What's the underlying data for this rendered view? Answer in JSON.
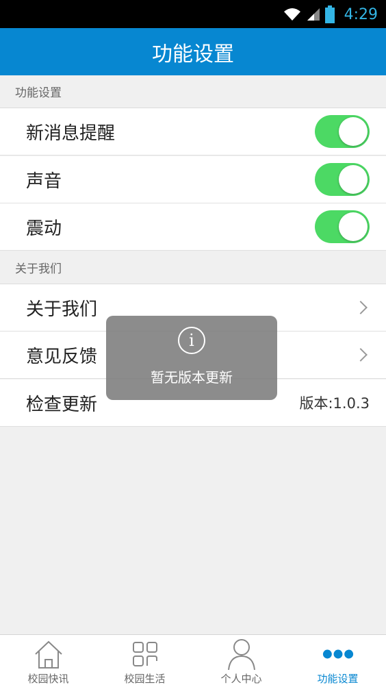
{
  "status_bar": {
    "time": "4:29"
  },
  "header": {
    "title": "功能设置"
  },
  "sections": [
    {
      "title": "功能设置"
    },
    {
      "title": "关于我们"
    }
  ],
  "settings": [
    {
      "label": "新消息提醒",
      "toggle_on": true
    },
    {
      "label": "声音",
      "toggle_on": true
    },
    {
      "label": "震动",
      "toggle_on": true
    }
  ],
  "about": [
    {
      "label": "关于我们"
    },
    {
      "label": "意见反馈"
    },
    {
      "label": "检查更新",
      "value": "版本:1.0.3"
    }
  ],
  "toast": {
    "message": "暂无版本更新"
  },
  "tabs": [
    {
      "label": "校园快讯",
      "icon": "home-icon"
    },
    {
      "label": "校园生活",
      "icon": "grid-icon"
    },
    {
      "label": "个人中心",
      "icon": "person-icon"
    },
    {
      "label": "功能设置",
      "icon": "more-dots-icon",
      "active": true
    }
  ],
  "colors": {
    "accent": "#0787d1",
    "toggle_on": "#4cd964",
    "status_time": "#33b5e5"
  }
}
